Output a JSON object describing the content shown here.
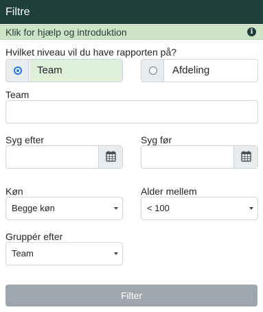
{
  "header": {
    "title": "Filtre"
  },
  "help_bar": {
    "text": "Klik for hjælp og introduktion",
    "icon": "info-icon"
  },
  "report_level": {
    "question": "Hvilket niveau vil du have rapporten på?",
    "options": [
      {
        "label": "Team",
        "checked": true
      },
      {
        "label": "Afdeling",
        "checked": false
      }
    ]
  },
  "team_field": {
    "label": "Team",
    "value": ""
  },
  "sick_after": {
    "label": "Syg efter",
    "value": "",
    "icon": "calendar-icon"
  },
  "sick_before": {
    "label": "Syg før",
    "value": "",
    "icon": "calendar-icon"
  },
  "gender": {
    "label": "Køn",
    "selected": "Begge køn"
  },
  "age": {
    "label": "Alder mellem",
    "selected": "< 100"
  },
  "group_by": {
    "label": "Gruppér efter",
    "selected": "Team"
  },
  "filter_button": {
    "label": "Filter"
  },
  "colors": {
    "header_bg": "#1e3f3a",
    "help_bg": "#cfe3c6",
    "selected_bg": "#dff0d8",
    "radio_accent": "#1a73e8",
    "button_bg": "#a0a6ad"
  }
}
